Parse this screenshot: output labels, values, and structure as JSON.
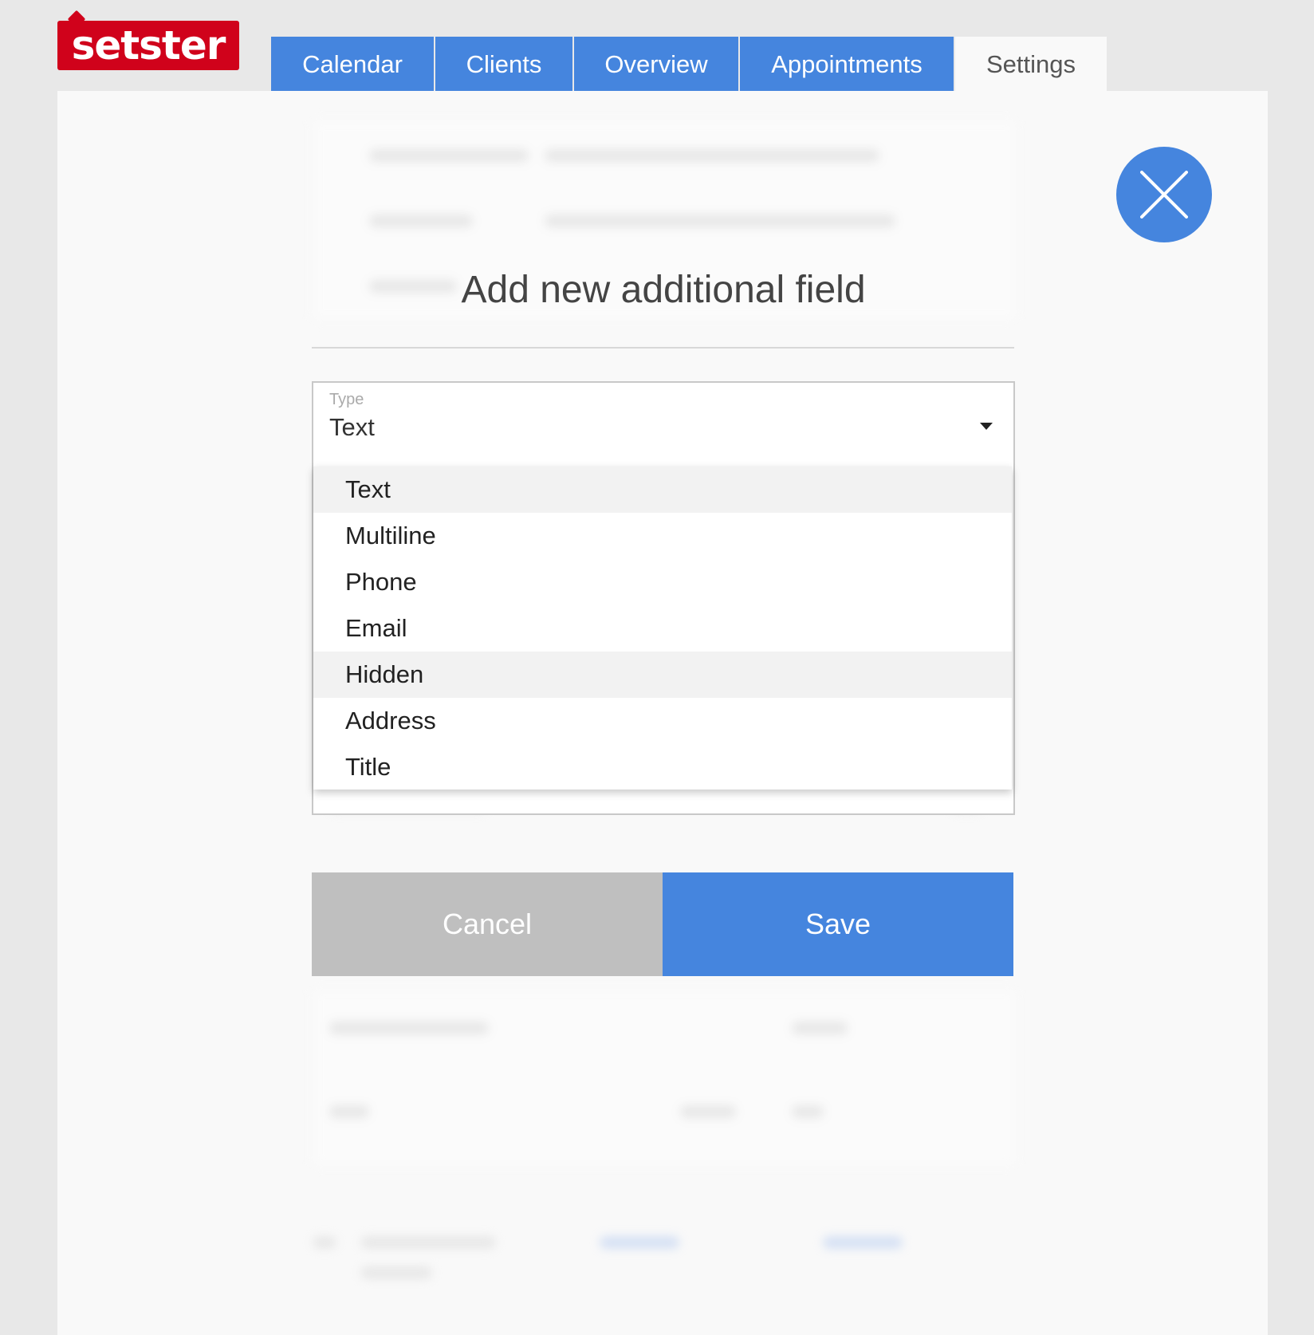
{
  "brand": {
    "logo_text": "setster",
    "color": "#d0021b"
  },
  "nav": {
    "tabs": [
      {
        "label": "Calendar",
        "active": false
      },
      {
        "label": "Clients",
        "active": false
      },
      {
        "label": "Overview",
        "active": false
      },
      {
        "label": "Appointments",
        "active": false
      },
      {
        "label": "Settings",
        "active": true
      }
    ]
  },
  "modal": {
    "title": "Add new additional field",
    "type_field": {
      "label": "Type",
      "value": "Text"
    },
    "options": [
      {
        "label": "Text",
        "highlighted": true
      },
      {
        "label": "Multiline",
        "highlighted": false
      },
      {
        "label": "Phone",
        "highlighted": false
      },
      {
        "label": "Email",
        "highlighted": false
      },
      {
        "label": "Hidden",
        "highlighted": true
      },
      {
        "label": "Address",
        "highlighted": false
      },
      {
        "label": "Title",
        "highlighted": false
      }
    ],
    "cancel_label": "Cancel",
    "save_label": "Save",
    "close_icon": "close-icon"
  },
  "colors": {
    "accent": "#4585de",
    "cancel": "#bfbfbf",
    "page_bg": "#e8e8e8"
  }
}
